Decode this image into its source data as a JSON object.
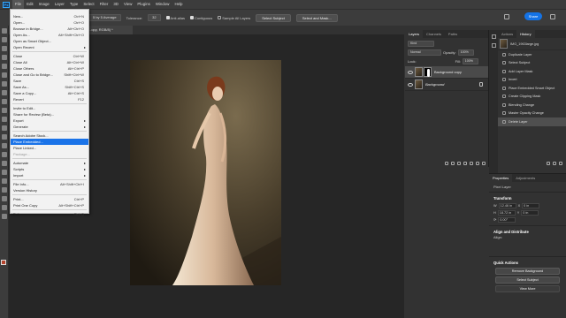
{
  "app": {
    "logo": "Ps"
  },
  "menu": [
    "File",
    "Edit",
    "Image",
    "Layer",
    "Type",
    "Select",
    "Filter",
    "3D",
    "View",
    "Plugins",
    "Window",
    "Help"
  ],
  "options": {
    "sample_size": "5 by 5 Average",
    "tolerance_label": "Tolerance:",
    "tolerance_value": "32",
    "anti_alias": "Anti-alias",
    "contiguous": "Contiguous",
    "sample_all": "Sample All Layers",
    "select_subject": "Select Subject",
    "select_mask": "Select and Mask...",
    "share": "Share"
  },
  "doc_tab": "...opy, RGB/8) *",
  "file_menu": [
    {
      "label": "New...",
      "shortcut": "Ctrl+N"
    },
    {
      "label": "Open...",
      "shortcut": "Ctrl+O"
    },
    {
      "label": "Browse in Bridge...",
      "shortcut": "Alt+Ctrl+O"
    },
    {
      "label": "Open As...",
      "shortcut": "Alt+Shift+Ctrl+O"
    },
    {
      "label": "Open as Smart Object...",
      "shortcut": ""
    },
    {
      "label": "Open Recent",
      "shortcut": "",
      "submenu": true
    },
    {
      "sep": true
    },
    {
      "label": "Close",
      "shortcut": "Ctrl+W"
    },
    {
      "label": "Close All",
      "shortcut": "Alt+Ctrl+W"
    },
    {
      "label": "Close Others",
      "shortcut": "Alt+Ctrl+P"
    },
    {
      "label": "Close and Go to Bridge...",
      "shortcut": "Shift+Ctrl+W"
    },
    {
      "label": "Save",
      "shortcut": "Ctrl+S"
    },
    {
      "label": "Save As...",
      "shortcut": "Shift+Ctrl+S"
    },
    {
      "label": "Save a Copy...",
      "shortcut": "Alt+Ctrl+S"
    },
    {
      "label": "Revert",
      "shortcut": "F12"
    },
    {
      "sep": true
    },
    {
      "label": "Invite to Edit...",
      "shortcut": ""
    },
    {
      "label": "Share for Review (Beta)...",
      "shortcut": ""
    },
    {
      "label": "Export",
      "shortcut": "",
      "submenu": true
    },
    {
      "label": "Generate",
      "shortcut": "",
      "submenu": true
    },
    {
      "sep": true
    },
    {
      "label": "Search Adobe Stock...",
      "shortcut": ""
    },
    {
      "label": "Place Embedded...",
      "shortcut": "",
      "selected": true
    },
    {
      "label": "Place Linked...",
      "shortcut": ""
    },
    {
      "label": "Package...",
      "shortcut": "",
      "disabled": true
    },
    {
      "sep": true
    },
    {
      "label": "Automate",
      "shortcut": "",
      "submenu": true
    },
    {
      "label": "Scripts",
      "shortcut": "",
      "submenu": true
    },
    {
      "label": "Import",
      "shortcut": "",
      "submenu": true
    },
    {
      "sep": true
    },
    {
      "label": "File Info...",
      "shortcut": "Alt+Shift+Ctrl+I"
    },
    {
      "label": "Version History",
      "shortcut": ""
    },
    {
      "sep": true
    },
    {
      "label": "Print...",
      "shortcut": "Ctrl+P"
    },
    {
      "label": "Print One Copy",
      "shortcut": "Alt+Shift+Ctrl+P"
    },
    {
      "sep": true
    },
    {
      "label": "Exit",
      "shortcut": "Ctrl+Q"
    }
  ],
  "layers": {
    "tabs": [
      "Layers",
      "Channels",
      "Paths"
    ],
    "kind": "Kind",
    "blend_mode": "Normal",
    "opacity_label": "Opacity:",
    "opacity": "100%",
    "lock_label": "Lock:",
    "fill_label": "Fill:",
    "fill": "100%",
    "items": [
      {
        "name": "Background copy",
        "selected": true
      },
      {
        "name": "Background",
        "selected": false
      }
    ]
  },
  "history": {
    "tabs": [
      "Actions",
      "History"
    ],
    "snapshot": "IMG_1963large.jpg",
    "items": [
      "Duplicate Layer",
      "Select Subject",
      "Add Layer Mask",
      "Invert",
      "Place Embedded Smart Object",
      "Create Clipping Mask",
      "Blending Change",
      "Master Opacity Change",
      "Delete Layer"
    ]
  },
  "properties": {
    "tabs": [
      "Properties",
      "Adjustments"
    ],
    "layer_type": "Pixel Layer",
    "transform": "Transform",
    "w": "12.46 in",
    "h": "18.72 in",
    "x": "0 in",
    "y": "0 in",
    "angle": "0.00°",
    "align": "Align and Distribute",
    "align_label": "Align:",
    "quick_actions": "Quick Actions",
    "remove_bg": "Remove Background",
    "select_subject": "Select Subject",
    "view_more": "View More"
  }
}
